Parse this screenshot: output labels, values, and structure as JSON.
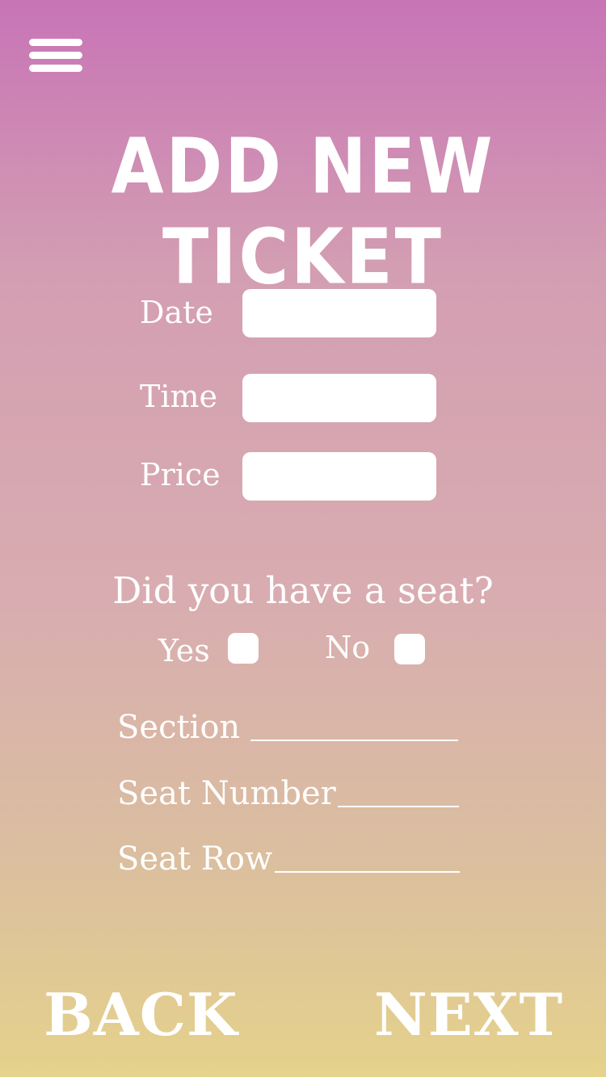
{
  "header": {
    "menu_icon": "hamburger-menu-icon",
    "title": "ADD NEW TICKET"
  },
  "form": {
    "date_label": "Date",
    "date_value": "",
    "time_label": "Time",
    "time_value": "",
    "price_label": "Price",
    "price_value": ""
  },
  "seat_question": {
    "text": "Did you have a seat?",
    "yes_label": "Yes",
    "yes_checked": false,
    "no_label": "No",
    "no_checked": false
  },
  "seat_details": {
    "section_label": "Section",
    "section_value": "",
    "seat_number_label": "Seat Number",
    "seat_number_value": "",
    "seat_row_label": "Seat Row",
    "seat_row_value": ""
  },
  "footer": {
    "back_label": "BACK",
    "next_label": "NEXT"
  },
  "colors": {
    "gradient_top": "#c874b6",
    "gradient_bottom": "#e5d28b",
    "foreground": "#ffffff"
  }
}
